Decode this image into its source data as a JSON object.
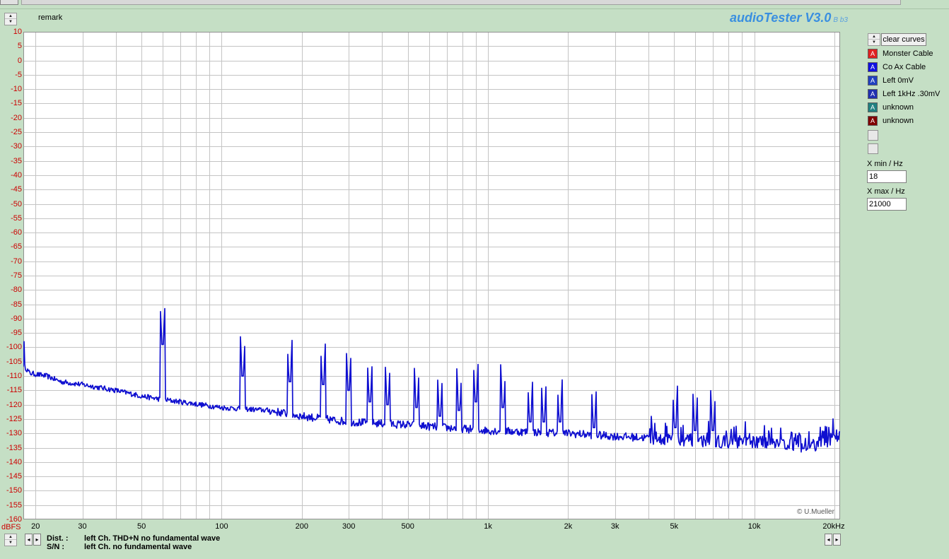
{
  "header": {
    "remark": "remark",
    "brand": "audioTester V3.0",
    "build": "B b3"
  },
  "chart_data": {
    "type": "line",
    "x_scale": "log",
    "xlim": [
      18,
      21000
    ],
    "ylim": [
      -160,
      10
    ],
    "y_unit_label": "dBFS",
    "y_ticks": [
      "10",
      "5",
      "0",
      "-5",
      "-10",
      "-15",
      "-20",
      "-25",
      "-30",
      "-35",
      "-40",
      "-45",
      "-50",
      "-55",
      "-60",
      "-65",
      "-70",
      "-75",
      "-80",
      "-85",
      "-90",
      "-95",
      "-100",
      "-105",
      "-110",
      "-115",
      "-120",
      "-125",
      "-130",
      "-135",
      "-140",
      "-145",
      "-150",
      "-155",
      "-160"
    ],
    "x_ticks": [
      {
        "value": 20,
        "label": "20"
      },
      {
        "value": 30,
        "label": "30"
      },
      {
        "value": 50,
        "label": "50"
      },
      {
        "value": 100,
        "label": "100"
      },
      {
        "value": 200,
        "label": "200"
      },
      {
        "value": 300,
        "label": "300"
      },
      {
        "value": 500,
        "label": "500"
      },
      {
        "value": 1000,
        "label": "1k"
      },
      {
        "value": 2000,
        "label": "2k"
      },
      {
        "value": 3000,
        "label": "3k"
      },
      {
        "value": 5000,
        "label": "5k"
      },
      {
        "value": 10000,
        "label": "10k"
      },
      {
        "value": 20000,
        "label": "20kHz"
      }
    ],
    "grid": true,
    "series": [
      {
        "color": "#1010d0",
        "baseline": [
          {
            "x": 18,
            "y": -106
          },
          {
            "x": 19,
            "y": -109
          },
          {
            "x": 22,
            "y": -110
          },
          {
            "x": 25,
            "y": -112
          },
          {
            "x": 30,
            "y": -113
          },
          {
            "x": 40,
            "y": -115
          },
          {
            "x": 50,
            "y": -117
          },
          {
            "x": 58,
            "y": -118
          },
          {
            "x": 70,
            "y": -119
          },
          {
            "x": 100,
            "y": -121
          },
          {
            "x": 150,
            "y": -122
          },
          {
            "x": 200,
            "y": -124
          },
          {
            "x": 300,
            "y": -126
          },
          {
            "x": 500,
            "y": -127
          },
          {
            "x": 700,
            "y": -128
          },
          {
            "x": 1000,
            "y": -129
          },
          {
            "x": 2000,
            "y": -130
          },
          {
            "x": 3000,
            "y": -131
          },
          {
            "x": 5000,
            "y": -132
          },
          {
            "x": 8000,
            "y": -133
          },
          {
            "x": 12000,
            "y": -133
          },
          {
            "x": 16000,
            "y": -135
          },
          {
            "x": 18500,
            "y": -133
          },
          {
            "x": 21000,
            "y": -130
          }
        ],
        "peaks": [
          {
            "x": 60,
            "y": -99
          },
          {
            "x": 120,
            "y": -110
          },
          {
            "x": 180,
            "y": -112
          },
          {
            "x": 240,
            "y": -113
          },
          {
            "x": 300,
            "y": -115
          },
          {
            "x": 360,
            "y": -119
          },
          {
            "x": 420,
            "y": -120
          },
          {
            "x": 540,
            "y": -121
          },
          {
            "x": 660,
            "y": -124
          },
          {
            "x": 780,
            "y": -122
          },
          {
            "x": 900,
            "y": -119
          },
          {
            "x": 1140,
            "y": -121
          },
          {
            "x": 1440,
            "y": -126
          },
          {
            "x": 1620,
            "y": -126
          },
          {
            "x": 1860,
            "y": -126
          },
          {
            "x": 2500,
            "y": -128
          },
          {
            "x": 5040,
            "y": -128
          },
          {
            "x": 6000,
            "y": -129
          },
          {
            "x": 7000,
            "y": -129
          }
        ]
      }
    ]
  },
  "sidebar": {
    "clear_curves": "clear curves",
    "legend": [
      {
        "label": "Monster Cable",
        "color": "#e02020",
        "glyph": "A"
      },
      {
        "label": "Co Ax Cable",
        "color": "#1010e0",
        "glyph": "A"
      },
      {
        "label": "Left 0mV",
        "color": "#2040c0",
        "glyph": "A"
      },
      {
        "label": "Left 1kHz .30mV",
        "color": "#2030b0",
        "glyph": "A"
      },
      {
        "label": "unknown",
        "color": "#208080",
        "glyph": "A"
      },
      {
        "label": "unknown",
        "color": "#800000",
        "glyph": "A"
      }
    ],
    "xmin_label": "X min / Hz",
    "xmin_value": "18",
    "xmax_label": "X max / Hz",
    "xmax_value": "21000"
  },
  "footer": {
    "copyright": "© U.Mueller",
    "dist_label": "Dist. :",
    "dist_text": "left Ch. THD+N  no fundamental wave",
    "sn_label": "S/N :",
    "sn_text": "left Ch.  no fundamental wave"
  }
}
